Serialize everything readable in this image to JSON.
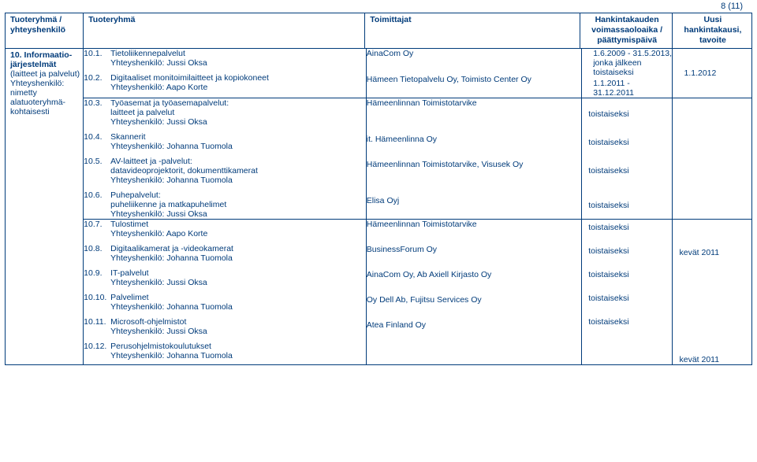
{
  "page_indicator": "8 (11)",
  "header": {
    "col_a": "Tuoteryhmä / yhteyshenkilö",
    "col_b": "Tuoteryhmä",
    "col_c": "Toimittajat",
    "col_d": "Hankintakauden voimassaoloaika / päättymispäivä",
    "col_e": "Uusi hankintakausi, tavoite"
  },
  "section": {
    "num": "10.",
    "title": "Informaatio-järjestelmät",
    "sub": "(laitteet ja palvelut)",
    "contact_label": "Yhteyshenkilö:",
    "contact_note": "nimetty alatuoteryhmä-kohtaisesti"
  },
  "rows": [
    {
      "num": "10.1.",
      "name": "Tietoliikennepalvelut",
      "contact": "Yhteyshenkilö: Jussi Oksa",
      "supplier": "AinaCom Oy",
      "period": "1.6.2009 - 31.5.2013, jonka jälkeen toistaiseksi",
      "target": ""
    },
    {
      "num": "10.2.",
      "name": "Digitaaliset monitoimilaitteet ja kopiokoneet",
      "contact": "Yhteyshenkilö: Aapo Korte",
      "supplier": "Hämeen Tietopalvelu Oy, Toimisto Center Oy",
      "period": "1.1.2011 - 31.12.2011",
      "target": "1.1.2012"
    },
    {
      "num": "10.3.",
      "name": "Työasemat ja työasemapalvelut:",
      "name2": "laitteet ja palvelut",
      "contact": "Yhteyshenkilö: Jussi Oksa",
      "supplier": "Hämeenlinnan Toimistotarvike",
      "period": "toistaiseksi",
      "target": ""
    },
    {
      "num": "10.4.",
      "name": "Skannerit",
      "contact": "Yhteyshenkilö: Johanna Tuomola",
      "supplier": "it. Hämeenlinna Oy",
      "period": "toistaiseksi",
      "target": ""
    },
    {
      "num": "10.5.",
      "name": "AV-laitteet ja -palvelut:",
      "name2": "datavideoprojektorit, dokumenttikamerat",
      "contact": "Yhteyshenkilö: Johanna Tuomola",
      "supplier": "Hämeenlinnan Toimistotarvike, Visusek Oy",
      "period": "toistaiseksi",
      "target": ""
    },
    {
      "num": "10.6.",
      "name": "Puhepalvelut:",
      "name2": "puheliikenne ja matkapuhelimet",
      "contact": "Yhteyshenkilö: Jussi Oksa",
      "supplier": "Elisa Oyj",
      "period": "toistaiseksi",
      "target": ""
    },
    {
      "num": "10.7.",
      "name": "Tulostimet",
      "contact": "Yhteyshenkilö: Aapo Korte",
      "supplier": "Hämeenlinnan Toimistotarvike",
      "period": "toistaiseksi",
      "target": ""
    },
    {
      "num": "10.8.",
      "name": "Digitaalikamerat ja -videokamerat",
      "contact": "Yhteyshenkilö: Johanna Tuomola",
      "supplier": "BusinessForum Oy",
      "period": "toistaiseksi",
      "target": "kevät 2011"
    },
    {
      "num": "10.9.",
      "name": "IT-palvelut",
      "contact": "Yhteyshenkilö: Jussi Oksa",
      "supplier": "AinaCom Oy, Ab Axiell Kirjasto Oy",
      "period": "toistaiseksi",
      "target": ""
    },
    {
      "num": "10.10.",
      "name": "Palvelimet",
      "contact": "Yhteyshenkilö: Johanna Tuomola",
      "supplier": "Oy Dell Ab, Fujitsu Services Oy",
      "period": "toistaiseksi",
      "target": ""
    },
    {
      "num": "10.11.",
      "name": "Microsoft-ohjelmistot",
      "contact": "Yhteyshenkilö: Jussi Oksa",
      "supplier": "Atea Finland Oy",
      "period": "toistaiseksi",
      "target": ""
    },
    {
      "num": "10.12.",
      "name": "Perusohjelmistokoulutukset",
      "contact": "Yhteyshenkilö: Johanna Tuomola",
      "supplier": "",
      "period": "",
      "target": "kevät 2011"
    }
  ]
}
